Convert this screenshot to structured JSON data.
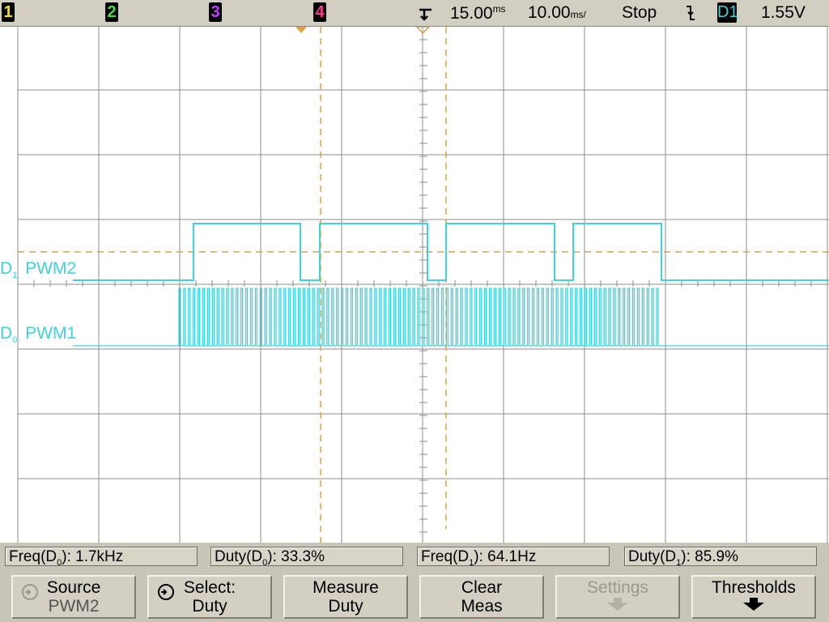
{
  "top_bar": {
    "channels": [
      {
        "label": "1",
        "color": "#f2e600"
      },
      {
        "label": "2",
        "color": "#44dd44"
      },
      {
        "label": "3",
        "color": "#c040ff"
      },
      {
        "label": "4",
        "color": "#ff3a8a"
      }
    ],
    "delay": "15.00",
    "delay_unit": "ms",
    "timebase": "10.00",
    "timebase_unit": "ms/",
    "run_state": "Stop",
    "trigger_source": "D1",
    "trigger_level": "1.55V"
  },
  "traces": [
    {
      "label": "PWM2",
      "indicator": "D",
      "sub": "1",
      "color": "#3ed2dc"
    },
    {
      "label": "PWM1",
      "indicator": "D",
      "sub": "0",
      "color": "#3ed2dc"
    }
  ],
  "measurements": [
    {
      "name": "Freq(D",
      "sub": "0",
      "tail": "):",
      "value": "1.7kHz"
    },
    {
      "name": "Duty(D",
      "sub": "0",
      "tail": "):",
      "value": "33.3%"
    },
    {
      "name": "Freq(D",
      "sub": "1",
      "tail": "):",
      "value": "64.1Hz"
    },
    {
      "name": "Duty(D",
      "sub": "1",
      "tail": "):",
      "value": "85.9%"
    }
  ],
  "softkeys": [
    {
      "line1": "Source",
      "line2": "PWM2",
      "enabled": true
    },
    {
      "line1": "Select:",
      "line2": "Duty",
      "enabled": true
    },
    {
      "line1": "Measure",
      "line2": "Duty",
      "enabled": true
    },
    {
      "line1": "Clear",
      "line2": "Meas",
      "enabled": true
    },
    {
      "line1": "Settings",
      "line2": "",
      "enabled": false
    },
    {
      "line1": "Thresholds",
      "line2": "",
      "enabled": true
    }
  ],
  "colors": {
    "trace": "#3ed2dc",
    "cursor": "#e0a040",
    "grid": "#8c8c8c",
    "background": "#ffffff"
  }
}
